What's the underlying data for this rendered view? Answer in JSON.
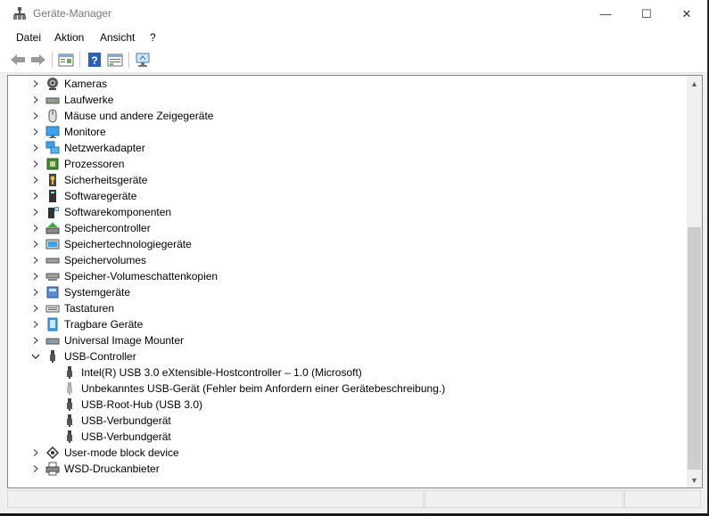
{
  "window": {
    "title": "Geräte-Manager",
    "controls": {
      "minimize": "—",
      "maximize": "☐",
      "close": "✕"
    }
  },
  "menu": [
    "Datei",
    "Aktion",
    "Ansicht",
    "?"
  ],
  "toolbar": [
    "back-icon",
    "forward-icon",
    "properties-icon",
    "help-icon",
    "view-icon",
    "monitor-scan-icon"
  ],
  "tree": [
    {
      "label": "Kameras",
      "icon": "camera-icon",
      "expanded": false,
      "level": 0
    },
    {
      "label": "Laufwerke",
      "icon": "drive-icon",
      "expanded": false,
      "level": 0
    },
    {
      "label": "Mäuse und andere Zeigegeräte",
      "icon": "mouse-icon",
      "expanded": false,
      "level": 0
    },
    {
      "label": "Monitore",
      "icon": "monitor-icon",
      "expanded": false,
      "level": 0
    },
    {
      "label": "Netzwerkadapter",
      "icon": "network-icon",
      "expanded": false,
      "level": 0
    },
    {
      "label": "Prozessoren",
      "icon": "processor-icon",
      "expanded": false,
      "level": 0
    },
    {
      "label": "Sicherheitsgeräte",
      "icon": "security-key-icon",
      "expanded": false,
      "level": 0
    },
    {
      "label": "Softwaregeräte",
      "icon": "software-device-icon",
      "expanded": false,
      "level": 0
    },
    {
      "label": "Softwarekomponenten",
      "icon": "software-component-icon",
      "expanded": false,
      "level": 0
    },
    {
      "label": "Speichercontroller",
      "icon": "storage-controller-icon",
      "expanded": false,
      "level": 0
    },
    {
      "label": "Speichertechnologiegeräte",
      "icon": "memory-technology-icon",
      "expanded": false,
      "level": 0
    },
    {
      "label": "Speichervolumes",
      "icon": "volume-icon",
      "expanded": false,
      "level": 0
    },
    {
      "label": "Speicher-Volumeschattenkopien",
      "icon": "shadow-copy-icon",
      "expanded": false,
      "level": 0
    },
    {
      "label": "Systemgeräte",
      "icon": "system-device-icon",
      "expanded": false,
      "level": 0
    },
    {
      "label": "Tastaturen",
      "icon": "keyboard-icon",
      "expanded": false,
      "level": 0
    },
    {
      "label": "Tragbare Geräte",
      "icon": "portable-device-icon",
      "expanded": false,
      "level": 0
    },
    {
      "label": "Universal Image Mounter",
      "icon": "image-mounter-icon",
      "expanded": false,
      "level": 0
    },
    {
      "label": "USB-Controller",
      "icon": "usb-icon",
      "expanded": true,
      "level": 0
    },
    {
      "label": "Intel(R) USB 3.0 eXtensible-Hostcontroller – 1.0 (Microsoft)",
      "icon": "usb-icon",
      "level": 1
    },
    {
      "label": "Unbekanntes USB-Gerät (Fehler beim Anfordern einer Gerätebeschreibung.)",
      "icon": "usb-unknown-icon",
      "level": 1
    },
    {
      "label": "USB-Root-Hub (USB 3.0)",
      "icon": "usb-icon",
      "level": 1
    },
    {
      "label": "USB-Verbundgerät",
      "icon": "usb-icon",
      "level": 1
    },
    {
      "label": "USB-Verbundgerät",
      "icon": "usb-icon",
      "level": 1
    },
    {
      "label": "User-mode block device",
      "icon": "block-device-icon",
      "expanded": false,
      "level": 0
    },
    {
      "label": "WSD-Druckanbieter",
      "icon": "printer-icon",
      "expanded": false,
      "level": 0
    }
  ],
  "colors": {
    "accent": "#1e78d7",
    "window_bg": "#f0f0f0",
    "text": "#000000"
  }
}
